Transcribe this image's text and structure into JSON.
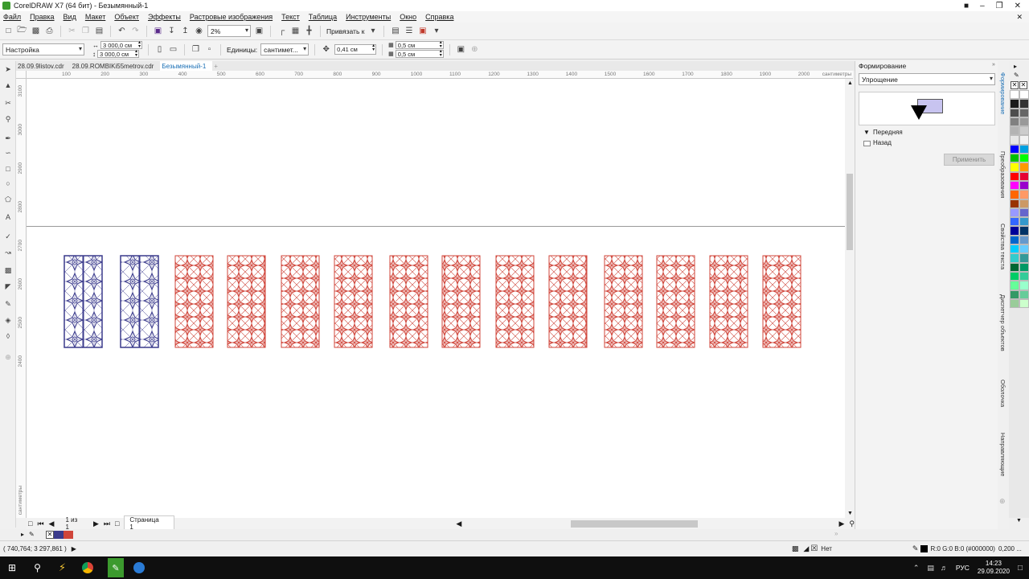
{
  "window": {
    "title": "CorelDRAW X7 (64 бит) - Безымянный-1"
  },
  "menu": [
    "Файл",
    "Правка",
    "Вид",
    "Макет",
    "Объект",
    "Эффекты",
    "Растровые изображения",
    "Текст",
    "Таблица",
    "Инструменты",
    "Окно",
    "Справка"
  ],
  "toolbar1": {
    "zoom": "2%",
    "snap_label": "Привязать к"
  },
  "toolbar2": {
    "preset": "Настройка",
    "width": "3 000,0 см",
    "height": "3 000,0 см",
    "units_label": "Единицы:",
    "units_value": "сантимет...",
    "nudge": "0,41 см",
    "dup_x": "0,5 см",
    "dup_y": "0,5 см"
  },
  "tabs": [
    {
      "label": "28.09.9listov.cdr",
      "active": false
    },
    {
      "label": "28.09.ROMBIKi55metrov.cdr",
      "active": false
    },
    {
      "label": "Безымянный-1",
      "active": true
    }
  ],
  "ruler": {
    "h_labels": [
      "100",
      "200",
      "300",
      "400",
      "500",
      "600",
      "700",
      "800",
      "900",
      "1000",
      "1100",
      "1200",
      "1300",
      "1400",
      "1500",
      "1600",
      "1700",
      "1800",
      "1900",
      "2000"
    ],
    "h_unit": "сантиметры",
    "v_labels": [
      "3100",
      "3000",
      "2900",
      "2800",
      "2700",
      "2600",
      "2500",
      "2400"
    ],
    "v_unit": "сантиметры"
  },
  "panels": {
    "blue_count": 2,
    "red_count": 12,
    "blue_color": "#3a3a8c",
    "red_color": "#d0453a"
  },
  "pagebar": {
    "page_count": "1 из 1",
    "page_tab": "Страница 1"
  },
  "status": {
    "coords": "( 740,764; 3 297,861 )",
    "fill_none": "Нет",
    "outline_color": "R:0 G:0 B:0 (#000000)",
    "outline_width": "0,200 ..."
  },
  "docker": {
    "title": "Формирование",
    "mode": "Упрощение",
    "opt_front": "Передняя",
    "opt_back": "Назад",
    "apply": "Применить"
  },
  "vtabs": [
    "Формирование",
    "Преобразования",
    "Свойства текста",
    "Диспетчер объектов",
    "Оболочка",
    "Направляющие"
  ],
  "palette": [
    "#ffffff",
    "#ffffff",
    "#1a1a1a",
    "#333333",
    "#4d4d4d",
    "#666666",
    "#808080",
    "#999999",
    "#b3b3b3",
    "#cccccc",
    "#e6e6e6",
    "#f2f2f2",
    "#0000ff",
    "#00a0e0",
    "#00c000",
    "#00ff00",
    "#ffff00",
    "#ff9900",
    "#ff0000",
    "#e60033",
    "#ff00ff",
    "#9900cc",
    "#ff6600",
    "#ff9966",
    "#993300",
    "#cc9966",
    "#9999ff",
    "#6666cc",
    "#3366ff",
    "#3399cc",
    "#000099",
    "#003366",
    "#0066cc",
    "#6699cc",
    "#00ccff",
    "#66ccff",
    "#33cccc",
    "#339999",
    "#006633",
    "#009966",
    "#00cc66",
    "#33cc99",
    "#66ff99",
    "#99ffcc",
    "#339966",
    "#66cc99",
    "#99cc99",
    "#ccffcc"
  ],
  "taskbar": {
    "lang": "РУС",
    "time": "14:23",
    "date": "29.09.2020"
  }
}
